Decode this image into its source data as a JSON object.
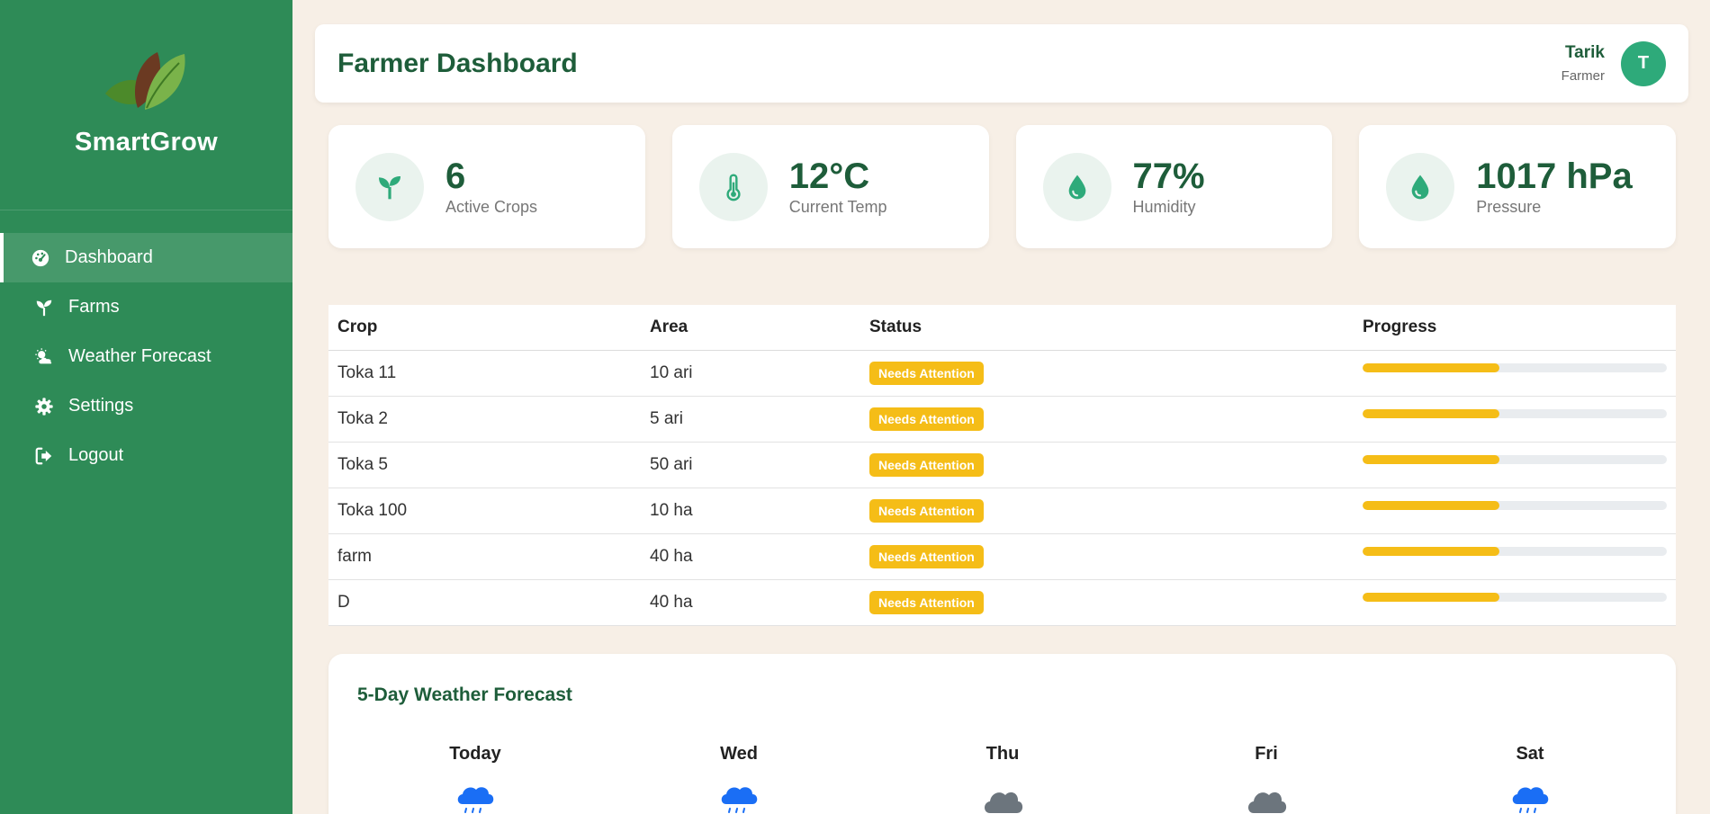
{
  "brand": {
    "name": "SmartGrow"
  },
  "nav": [
    {
      "label": "Dashboard",
      "icon": "gauge-icon",
      "active": true
    },
    {
      "label": "Farms",
      "icon": "seedling-icon"
    },
    {
      "label": "Weather Forecast",
      "icon": "cloud-sun-icon"
    },
    {
      "label": "Settings",
      "icon": "gear-icon"
    },
    {
      "label": "Logout",
      "icon": "logout-icon"
    }
  ],
  "header": {
    "title": "Farmer Dashboard"
  },
  "user": {
    "name": "Tarik",
    "role": "Farmer",
    "initial": "T"
  },
  "stats": [
    {
      "value": "6",
      "label": "Active Crops",
      "icon": "seedling-icon"
    },
    {
      "value": "12°C",
      "label": "Current Temp",
      "icon": "thermometer-icon"
    },
    {
      "value": "77%",
      "label": "Humidity",
      "icon": "droplet-icon"
    },
    {
      "value": "1017 hPa",
      "label": "Pressure",
      "icon": "droplet-icon"
    }
  ],
  "crops_table": {
    "columns": [
      "Crop",
      "Area",
      "Status",
      "Progress"
    ],
    "rows": [
      {
        "crop": "Toka 11",
        "area": "10 ari",
        "status": "Needs Attention",
        "progress": 45
      },
      {
        "crop": "Toka 2",
        "area": "5 ari",
        "status": "Needs Attention",
        "progress": 45
      },
      {
        "crop": "Toka 5",
        "area": "50 ari",
        "status": "Needs Attention",
        "progress": 45
      },
      {
        "crop": "Toka 100",
        "area": "10 ha",
        "status": "Needs Attention",
        "progress": 45
      },
      {
        "crop": "farm",
        "area": "40 ha",
        "status": "Needs Attention",
        "progress": 45
      },
      {
        "crop": "D",
        "area": "40 ha",
        "status": "Needs Attention",
        "progress": 45
      }
    ]
  },
  "weather": {
    "title": "5-Day Weather Forecast",
    "days": [
      {
        "name": "Today",
        "icon": "cloud-rain-icon"
      },
      {
        "name": "Wed",
        "icon": "cloud-rain-icon"
      },
      {
        "name": "Thu",
        "icon": "cloud-icon"
      },
      {
        "name": "Fri",
        "icon": "cloud-icon"
      },
      {
        "name": "Sat",
        "icon": "cloud-rain-icon"
      }
    ]
  },
  "colors": {
    "sidebar": "#2e8b57",
    "accent": "#1e5d3a",
    "badge": "#f5bd17",
    "rain_icon": "#1a6ef5",
    "cloud_icon": "#6c757d"
  }
}
